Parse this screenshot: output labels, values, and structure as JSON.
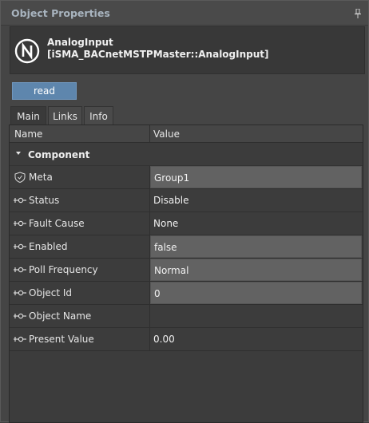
{
  "panel": {
    "title": "Object Properties",
    "pin_icon": "pin-icon"
  },
  "header": {
    "logo_icon": "niagara-n-icon",
    "name": "AnalogInput",
    "type": "[iSMA_BACnetMSTPMaster::AnalogInput]"
  },
  "toolbar": {
    "read_label": "read"
  },
  "tabs": [
    {
      "label": "Main",
      "active": true
    },
    {
      "label": "Links",
      "active": false
    },
    {
      "label": "Info",
      "active": false
    }
  ],
  "table": {
    "columns": [
      "Name",
      "Value"
    ],
    "group": "Component",
    "rows": [
      {
        "name": "Meta",
        "value": "Group1",
        "icon": "shield-icon",
        "editable": true
      },
      {
        "name": "Status",
        "value": "Disable",
        "icon": "slot-icon",
        "editable": false
      },
      {
        "name": "Fault Cause",
        "value": "None",
        "icon": "slot-icon",
        "editable": false
      },
      {
        "name": "Enabled",
        "value": "false",
        "icon": "slot-icon",
        "editable": true
      },
      {
        "name": "Poll Frequency",
        "value": "Normal",
        "icon": "slot-icon",
        "editable": true
      },
      {
        "name": "Object Id",
        "value": "0",
        "icon": "slot-icon",
        "editable": true
      },
      {
        "name": "Object Name",
        "value": "",
        "icon": "slot-icon",
        "editable": false
      },
      {
        "name": "Present Value",
        "value": "0.00",
        "icon": "slot-icon",
        "editable": false
      }
    ]
  }
}
